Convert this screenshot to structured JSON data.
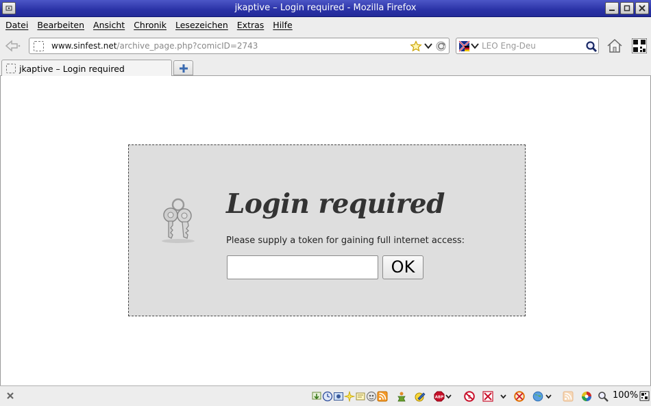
{
  "window": {
    "title": "jkaptive – Login required - Mozilla Firefox"
  },
  "menubar": {
    "items": [
      "Datei",
      "Bearbeiten",
      "Ansicht",
      "Chronik",
      "Lesezeichen",
      "Extras",
      "Hilfe"
    ]
  },
  "navbar": {
    "url_host": "www.sinfest.net",
    "url_path": "/archive_page.php?comicID=2743",
    "search_placeholder": "LEO Eng-Deu"
  },
  "tabs": [
    {
      "label": "jkaptive – Login required"
    }
  ],
  "login": {
    "title": "Login required",
    "description": "Please supply a token for gaining full internet access:",
    "token_value": "",
    "ok_label": "OK"
  },
  "statusbar": {
    "zoom": "100%"
  },
  "colors": {
    "titlebar": "#2a32a6",
    "chrome": "#ededed",
    "login_box": "#dedede"
  }
}
